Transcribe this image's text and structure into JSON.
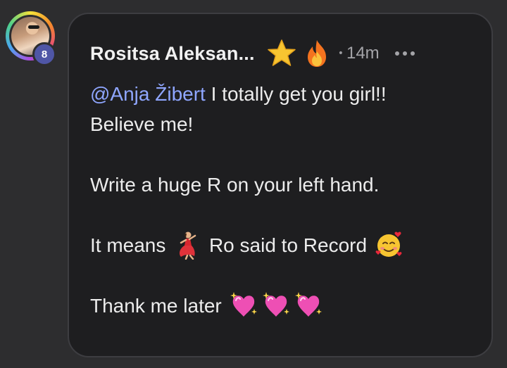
{
  "author": {
    "name": "Rositsa Aleksan...",
    "level": "8",
    "badges": [
      "star-icon",
      "fire-icon"
    ]
  },
  "meta": {
    "separator": "•",
    "time": "14m",
    "more_icon": "more-dots-icon"
  },
  "comment": {
    "mention": "@Anja Žibert",
    "line1_rest": " I totally get you girl!!",
    "line2": "Believe me!",
    "line3": "Write a huge R on your left hand.",
    "line4_a": "It means ",
    "line4_b": " Ro said to Record ",
    "line5": "Thank me later "
  },
  "emojis": {
    "dancer": "dancer-emoji",
    "hearts_face": "smiling-face-with-hearts-emoji",
    "sparkling_heart": "sparkling-heart-emoji"
  },
  "colors": {
    "background": "#2d2d2f",
    "card": "#1e1e20",
    "mention": "#8fa6ff",
    "level_badge": "#4f56a6"
  }
}
